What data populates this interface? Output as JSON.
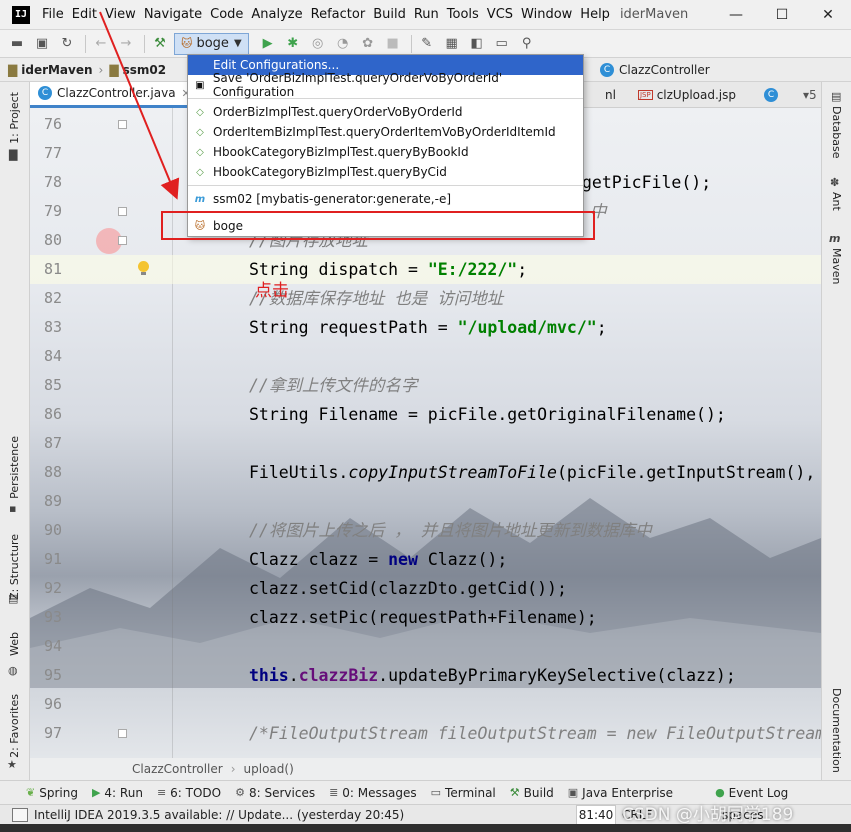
{
  "app": {
    "logo_text": "IJ",
    "menu": [
      "File",
      "Edit",
      "View",
      "Navigate",
      "Code",
      "Analyze",
      "Refactor",
      "Build",
      "Run",
      "Tools",
      "VCS",
      "Window",
      "Help"
    ],
    "window_title": "iderMaven",
    "controls": {
      "minimize": "—",
      "maximize": "☐",
      "close": "✕"
    }
  },
  "toolbar": {
    "run_config_label": "boge"
  },
  "navbar": {
    "crumbs": [
      "iderMaven",
      "ssm02"
    ],
    "right_crumb": "ClazzController"
  },
  "tabs": {
    "active": "ClazzController.java",
    "right_partial": "nl",
    "jsp_tab": "clzUpload.jsp",
    "overflow": "▾5"
  },
  "left_strip": {
    "project": "1: Project",
    "persistence": "Persistence",
    "structure": "Z: Structure",
    "web": "Web",
    "favorites": "2: Favorites"
  },
  "right_strip": {
    "database": "Database",
    "ant": "Ant",
    "maven": "Maven",
    "documentation": "Documentation"
  },
  "popup": {
    "edit_configurations": "Edit Configurations...",
    "save_configuration": "Save 'OrderBizImplTest.queryOrderVoByOrderId' Configuration",
    "tests": [
      "OrderBizImplTest.queryOrderVoByOrderId",
      "OrderItemBizImplTest.queryOrderItemVoByOrderIdItemId",
      "HbookCategoryBizImplTest.queryByBookId",
      "HbookCategoryBizImplTest.queryByCid"
    ],
    "maven_config": "ssm02 [mybatis-generator:generate,-e]",
    "boge": "boge"
  },
  "editor": {
    "line_numbers": [
      "76",
      "77",
      "78",
      "79",
      "80",
      "81",
      "82",
      "83",
      "84",
      "85",
      "86",
      "87",
      "88",
      "89",
      "90",
      "91",
      "92",
      "93",
      "94",
      "95",
      "96",
      "97"
    ],
    "code": {
      "l78_tail": "getPicFile();",
      "l79_tail": "中",
      "l80": "//图片存放地址",
      "l81_a": "String dispatch = ",
      "l81_b": "\"E:/222/\"",
      "l81_c": ";",
      "l82": "//数据库保存地址 也是 访问地址",
      "l83_a": "String requestPath = ",
      "l83_b": "\"/upload/mvc/\"",
      "l83_c": ";",
      "l85": "//拿到上传文件的名字",
      "l86": "String Filename = picFile.getOriginalFilename();",
      "l88_a": "FileUtils.",
      "l88_b": "copyInputStreamToFile",
      "l88_c": "(picFile.getInputStream(),",
      "l90": "//将图片上传之后 ， 并且将图片地址更新到数据库中",
      "l91_a": "Clazz clazz = ",
      "l91_b": "new",
      "l91_c": " Clazz();",
      "l92": "clazz.setCid(clazzDto.getCid());",
      "l93": "clazz.setPic(requestPath+Filename);",
      "l95_a": "this",
      "l95_b": ".",
      "l95_c": "clazzBiz",
      "l95_d": ".updateByPrimaryKeySelective(clazz);",
      "l97": "/*FileOutputStream fileOutputStream = new FileOutputStream"
    },
    "annotation": "点击"
  },
  "editor_crumbs": [
    "ClazzController",
    "upload()"
  ],
  "bottombar": {
    "spring": "Spring",
    "run": "4: Run",
    "todo": "6: TODO",
    "services": "8: Services",
    "messages": "0: Messages",
    "terminal": "Terminal",
    "build": "Build",
    "java_enterprise": "Java Enterprise",
    "event_log": "Event Log"
  },
  "statusbar": {
    "message": "IntelliJ IDEA 2019.3.5 available: // Update... (yesterday 20:45)",
    "position": "81:40",
    "encoding": "CRLF",
    "tail": "spaces",
    "watermark": "CSDN @小胡同学189"
  }
}
